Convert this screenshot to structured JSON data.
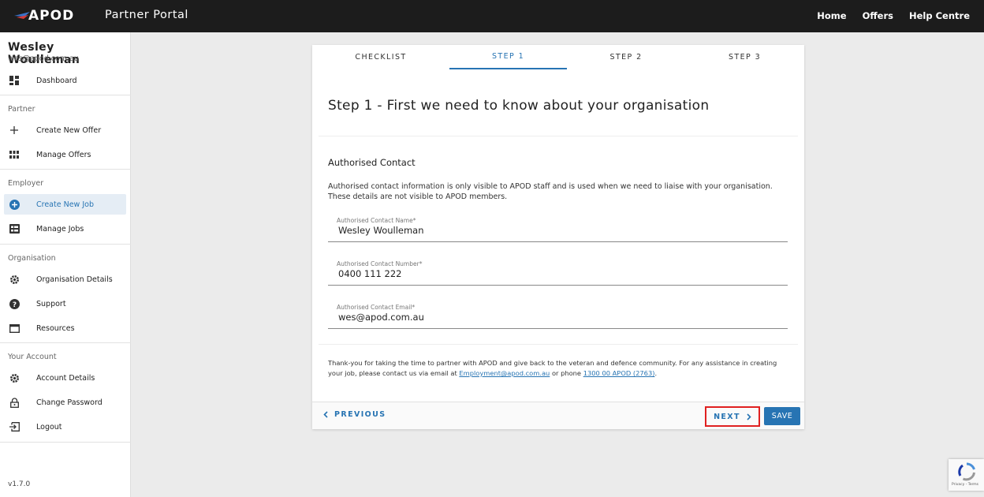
{
  "header": {
    "logo_text": "APOD",
    "portal_title": "Partner Portal",
    "nav": [
      "Home",
      "Offers",
      "Help Centre"
    ]
  },
  "user": {
    "name": "Wesley Woulleman",
    "email": "wes@apod.com.au"
  },
  "sidebar": {
    "dashboard": "Dashboard",
    "sections": {
      "partner": "Partner",
      "employer": "Employer",
      "organisation": "Organisation",
      "account": "Your Account"
    },
    "items": {
      "create_offer": "Create New Offer",
      "manage_offers": "Manage Offers",
      "create_job": "Create New Job",
      "manage_jobs": "Manage Jobs",
      "org_details": "Organisation Details",
      "support": "Support",
      "resources": "Resources",
      "account_details": "Account Details",
      "change_password": "Change Password",
      "logout": "Logout"
    },
    "active_item": "Create New Job",
    "version": "v1.7.0"
  },
  "tabs": [
    "CHECKLIST",
    "STEP 1",
    "STEP 2",
    "STEP 3"
  ],
  "active_tab": "STEP 1",
  "form": {
    "heading": "Step 1 - First we need to know about your organisation",
    "subheading": "Authorised Contact",
    "description": "Authorised contact information is only visible to APOD staff and is used when we need to liaise with your organisation. These details are not visible to APOD members.",
    "fields": [
      {
        "label": "Authorised Contact Name*",
        "value": "Wesley Woulleman"
      },
      {
        "label": "Authorised Contact Number*",
        "value": "0400 111 222"
      },
      {
        "label": "Authorised Contact Email*",
        "value": "wes@apod.com.au"
      }
    ],
    "footer": {
      "text_before": "Thank-you for taking the time to partner with APOD and give back to the veteran and defence community. For any assistance in creating your job, please contact us via email at ",
      "email_link": "Employment@apod.com.au",
      "text_middle": " or phone ",
      "phone_link": "1300 00 APOD (2763)",
      "text_after": "."
    }
  },
  "actions": {
    "previous": "PREVIOUS",
    "next": "NEXT",
    "save": "SAVE"
  },
  "recaptcha": {
    "text": "Privacy - Terms"
  },
  "colors": {
    "accent": "#2774b3",
    "topbar": "#1c1c1c",
    "highlight_border": "#e02020"
  }
}
